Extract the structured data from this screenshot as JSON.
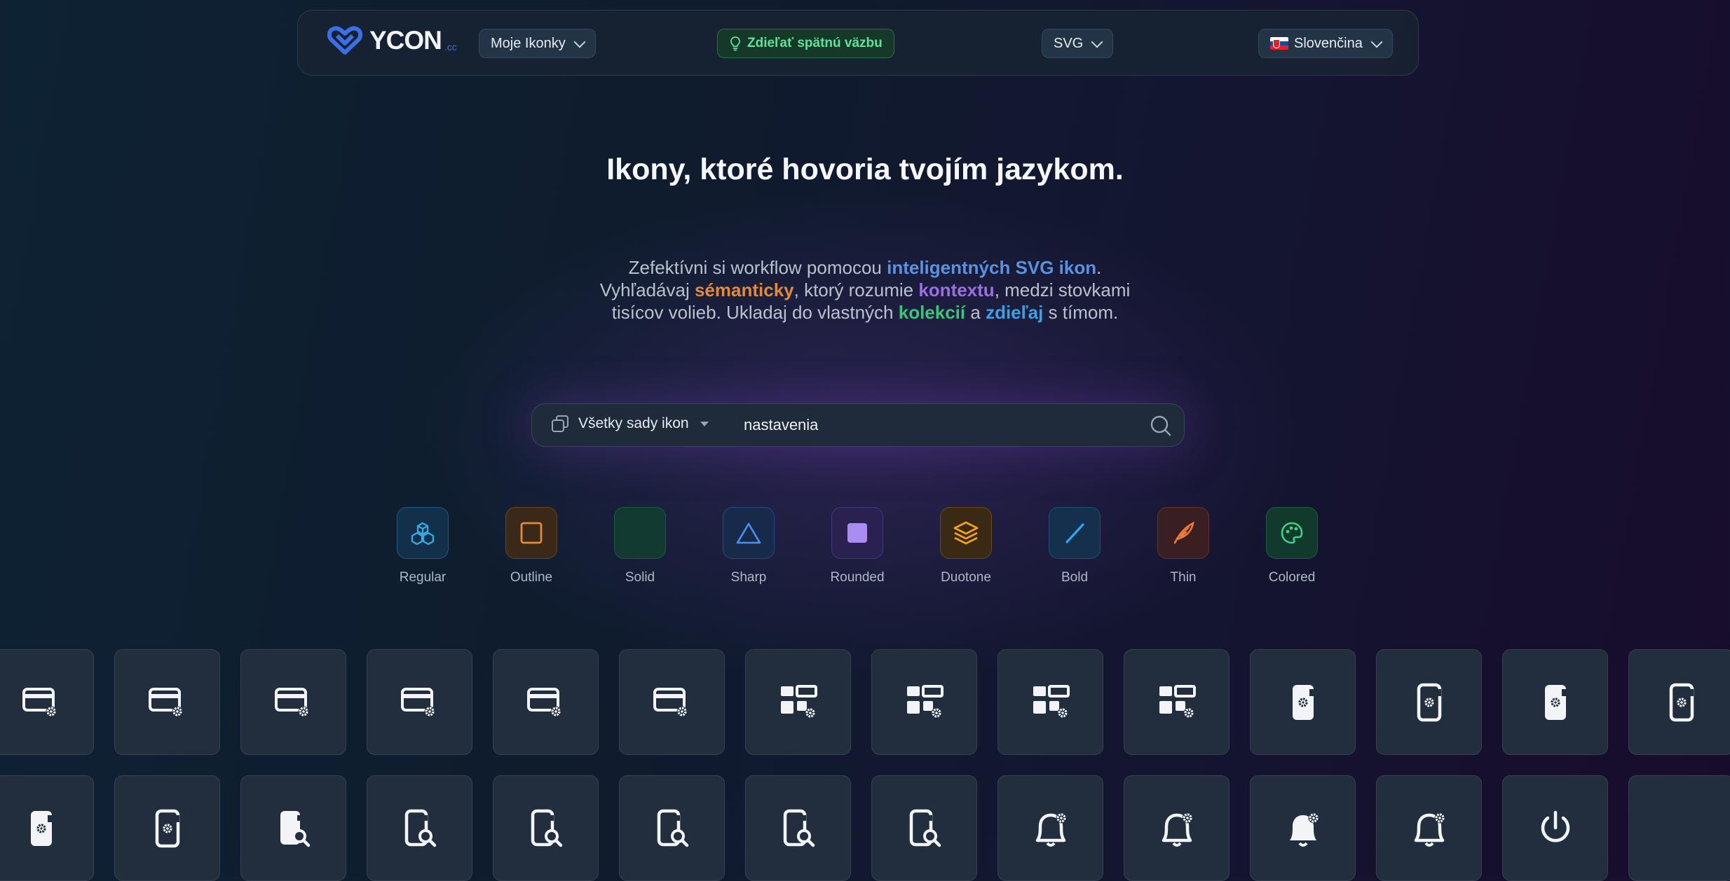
{
  "header": {
    "logo_text": "YCON",
    "logo_tld": ".cc",
    "my_icons_label": "Moje Ikonky",
    "feedback_label": "Zdieľať spätnú väzbu",
    "format_label": "SVG",
    "language_label": "Slovenčina"
  },
  "hero": {
    "headline": "Ikony, ktoré hovoria tvojím jazykom.",
    "line1_a": "Zefektívni si workflow pomocou ",
    "line1_hl": "inteligentných SVG ikon",
    "line1_b": ".",
    "line2_a": "Vyhľadávaj ",
    "line2_hl1": "sémanticky",
    "line2_b": ", ktorý rozumie ",
    "line2_hl2": "kontextu",
    "line2_c": ", medzi stovkami",
    "line3_a": "tisícov volieb. Ukladaj do vlastných ",
    "line3_hl1": "kolekcií",
    "line3_b": " a ",
    "line3_hl2": "zdieľaj",
    "line3_c": " s tímom."
  },
  "search": {
    "set_label": "Všetky sady ikon",
    "value": "nastavenia"
  },
  "styles": [
    {
      "label": "Regular",
      "icon": "cubes-icon"
    },
    {
      "label": "Outline",
      "icon": "square-outline-icon"
    },
    {
      "label": "Solid",
      "icon": "solid-icon"
    },
    {
      "label": "Sharp",
      "icon": "triangle-icon"
    },
    {
      "label": "Rounded",
      "icon": "rounded-square-icon"
    },
    {
      "label": "Duotone",
      "icon": "layers-icon"
    },
    {
      "label": "Bold",
      "icon": "bold-slash-icon"
    },
    {
      "label": "Thin",
      "icon": "feather-icon"
    },
    {
      "label": "Colored",
      "icon": "palette-icon"
    }
  ],
  "results": [
    "card-settings-icon",
    "card-settings-icon",
    "card-settings-icon",
    "card-settings-icon",
    "card-settings-icon",
    "card-settings-icon",
    "dashboard-settings-icon",
    "dashboard-settings-icon",
    "dashboard-settings-icon",
    "dashboard-settings-icon",
    "phone-settings-icon",
    "phone-settings-icon",
    "phone-settings-icon",
    "phone-settings-icon",
    "phone-settings-icon",
    "phone-settings-icon",
    "phone-search-icon",
    "phone-search-icon",
    "phone-search-icon",
    "phone-search-icon",
    "phone-search-icon",
    "phone-search-icon",
    "bell-settings-icon",
    "bell-settings-icon",
    "bell-settings-icon",
    "bell-settings-icon",
    "power-icon",
    "blank-icon"
  ],
  "colors": {
    "accent_blue": "#5a92e0",
    "accent_green": "#3fc27a",
    "accent_orange": "#e08a3c",
    "accent_purple": "#9a6fe0"
  }
}
